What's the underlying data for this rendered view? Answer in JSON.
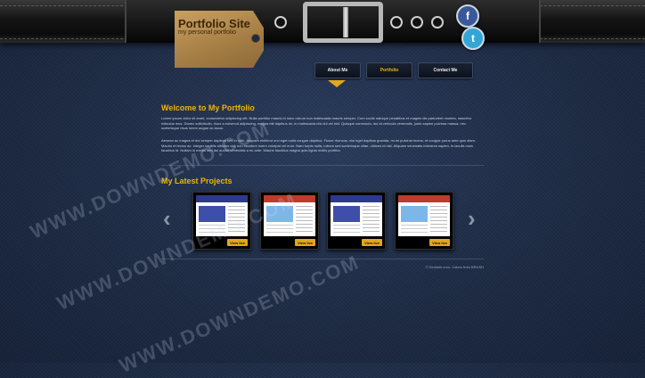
{
  "site": {
    "title": "Portfolio Site",
    "tagline": "my personal portfolio"
  },
  "social": {
    "facebook_glyph": "f",
    "twitter_glyph": "t"
  },
  "nav": {
    "items": [
      {
        "label": "About Me"
      },
      {
        "label": "Portfolio",
        "active": true
      },
      {
        "label": "Contact Me"
      }
    ]
  },
  "welcome": {
    "title": "Welcome to My Portfolio",
    "para1": "Lorem ipsum dolor sit amet, consectetur adipiscing elit. Nulla porttitor mauris id nunc rutrum non malesuada mauris semper. Cum sociis natoque penatibus et magnis dis parturient montes, nascetur ridiculus mus. Donec sollicitudin, risus a euismod adipiscing, magna elit dapibus mi, in malesuada nisl dui vel nisl. Quisque commodo, dui at vehicula venenatis, justo sapien pulvinar massa, nec scelerisque risus lorem augue ac lacus.",
    "para2": "Aenean ac magna et dui semper dapibus sed in nibh. Aliquam eleifend orci eget nulla congue dapibus. Fusce rhoncus, nisl eget dapibus gravida, mi mi pulvinar lectus, et congue purus ante quis diam. Mauris et lectus ac. Integer sagittis ultricies dui, non tincidunt lorem volutpat vel eros. Nam turpis nulla, rutrum sed scelerisque vitae, ultrices id nisl. Aliquam venenatis interdum sapien, in iaculis nunc faucibus id. Nullam in metus sed dui auctor venenatis a eu ante. Mauris faucibus magna quis ligula mollis porttitor."
  },
  "projects": {
    "title": "My Latest Projects",
    "prev_glyph": "‹",
    "next_glyph": "›",
    "items": [
      {
        "view_label": "View live",
        "accent": "#2d3a8c"
      },
      {
        "view_label": "View live",
        "accent": "#c0392b"
      },
      {
        "view_label": "View live",
        "accent": "#2d3a8c"
      },
      {
        "view_label": "View live",
        "accent": "#c0392b"
      }
    ]
  },
  "footer": {
    "text": "© Denimie.com. Colors from BRUSH"
  },
  "watermark": {
    "text": "WWW.DOWNDEMO.COM"
  },
  "colors": {
    "accent": "#f0b400",
    "denim": "#1f2d47",
    "tag": "#b48a4f"
  }
}
